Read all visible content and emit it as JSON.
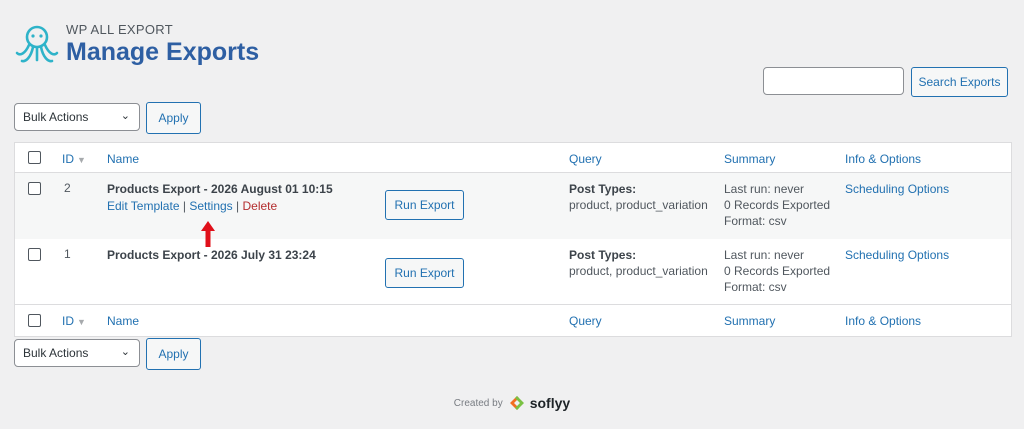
{
  "header": {
    "brand_small": "WP ALL EXPORT",
    "title": "Manage Exports"
  },
  "search": {
    "value": "",
    "button_label": "Search Exports"
  },
  "bulk_top": {
    "selected": "Bulk Actions",
    "apply_label": "Apply"
  },
  "bulk_bottom": {
    "selected": "Bulk Actions",
    "apply_label": "Apply"
  },
  "table": {
    "columns": {
      "id": "ID",
      "name": "Name",
      "query": "Query",
      "summary": "Summary",
      "info": "Info & Options"
    },
    "rows": [
      {
        "id": "2",
        "name": "Products Export - 2026 August 01 10:15",
        "actions": {
          "edit": "Edit Template",
          "settings": "Settings",
          "delete": "Delete",
          "sep": "|"
        },
        "run_label": "Run Export",
        "query_label": "Post Types:",
        "query_value": "product, product_variation",
        "summary": [
          "Last run: never",
          "0 Records Exported",
          "Format: csv"
        ],
        "info_link": "Scheduling Options"
      },
      {
        "id": "1",
        "name": "Products Export - 2026 July 31 23:24",
        "run_label": "Run Export",
        "query_label": "Post Types:",
        "query_value": "product, product_variation",
        "summary": [
          "Last run: never",
          "0 Records Exported",
          "Format: csv"
        ],
        "info_link": "Scheduling Options"
      }
    ]
  },
  "footer": {
    "created_by": "Created by",
    "company": "soflyy"
  },
  "colors": {
    "link": "#2271b1",
    "brand": "#2e5fa3",
    "delete": "#b32d2e",
    "arrow": "#e0101a"
  },
  "icons": {
    "logo": "octopus-logo-icon",
    "sort": "sort-arrow-icon",
    "chevron": "chevron-down-icon",
    "annotation": "red-arrow-up-icon"
  }
}
